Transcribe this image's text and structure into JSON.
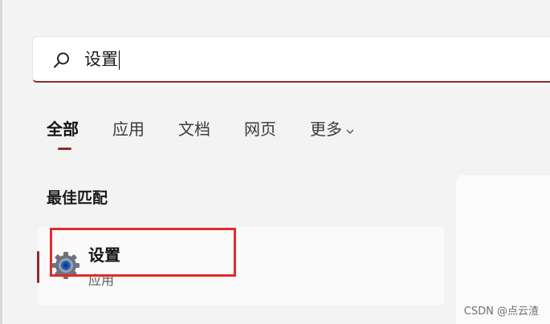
{
  "search": {
    "query": "设置"
  },
  "tabs": [
    {
      "label": "全部",
      "active": true
    },
    {
      "label": "应用"
    },
    {
      "label": "文档"
    },
    {
      "label": "网页"
    },
    {
      "label": "更多"
    }
  ],
  "best_match": {
    "section_title": "最佳匹配",
    "result": {
      "title": "设置",
      "subtitle": "应用",
      "icon": "gear-icon"
    }
  },
  "watermark": "CSDN @点云渣",
  "colors": {
    "accent": "#8a2c2c",
    "highlight": "#e32a2a"
  }
}
